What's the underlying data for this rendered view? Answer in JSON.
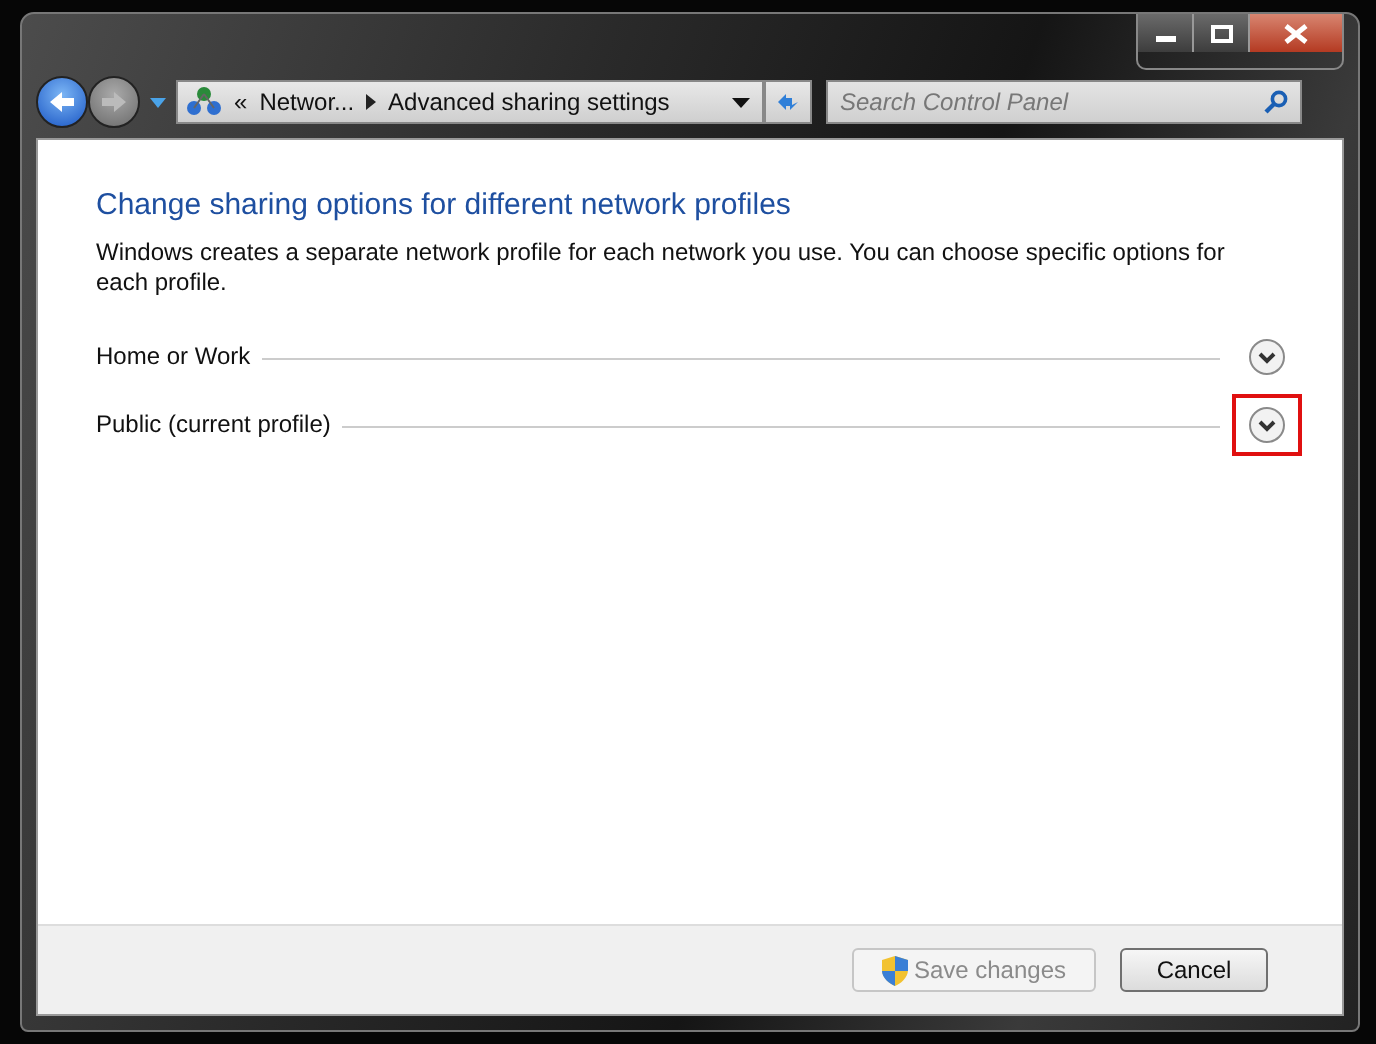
{
  "address_bar": {
    "overflow": "«",
    "crumbs": [
      "Networ...",
      "Advanced sharing settings"
    ]
  },
  "search": {
    "placeholder": "Search Control Panel"
  },
  "heading": "Change sharing options for different network profiles",
  "description": "Windows creates a separate network profile for each network you use. You can choose specific options for each profile.",
  "profiles": [
    {
      "label": "Home or Work",
      "expanded": false,
      "highlighted": false
    },
    {
      "label": "Public (current profile)",
      "expanded": false,
      "highlighted": true
    }
  ],
  "buttons": [
    {
      "label": "Save changes",
      "disabled": true,
      "kind": "shield"
    },
    {
      "label": "Cancel",
      "disabled": false,
      "kind": "plain"
    }
  ]
}
